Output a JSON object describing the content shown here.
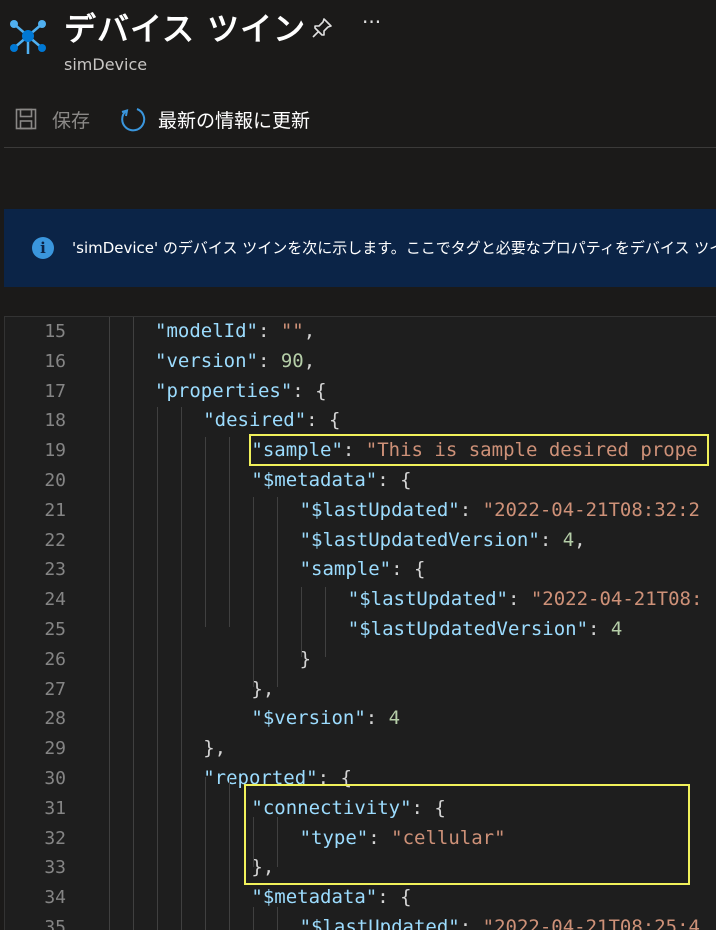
{
  "header": {
    "title": "デバイス ツイン",
    "subtitle": "simDevice",
    "more_label": "···"
  },
  "toolbar": {
    "save_label": "保存",
    "refresh_label": "最新の情報に更新"
  },
  "info_bar": {
    "icon_glyph": "i",
    "message": "'simDevice' のデバイス ツインを次に示します。ここでタグと必要なプロパティをデバイス ツイン"
  },
  "editor": {
    "lines": [
      {
        "num": "15",
        "tokens": [
          [
            "k",
            "\"modelId\""
          ],
          [
            "p",
            ": "
          ],
          [
            "s",
            "\"\""
          ],
          [
            "p",
            ","
          ]
        ]
      },
      {
        "num": "16",
        "tokens": [
          [
            "k",
            "\"version\""
          ],
          [
            "p",
            ": "
          ],
          [
            "n",
            "90"
          ],
          [
            "p",
            ","
          ]
        ]
      },
      {
        "num": "17",
        "tokens": [
          [
            "k",
            "\"properties\""
          ],
          [
            "p",
            ": {"
          ]
        ]
      },
      {
        "num": "18",
        "tokens": [
          [
            "k",
            "\"desired\""
          ],
          [
            "p",
            ": {"
          ]
        ]
      },
      {
        "num": "19",
        "tokens": [
          [
            "k",
            "\"sample\""
          ],
          [
            "p",
            ": "
          ],
          [
            "s",
            "\"This is sample desired prope"
          ]
        ]
      },
      {
        "num": "20",
        "tokens": [
          [
            "k",
            "\"$metadata\""
          ],
          [
            "p",
            ": {"
          ]
        ]
      },
      {
        "num": "21",
        "tokens": [
          [
            "k",
            "\"$lastUpdated\""
          ],
          [
            "p",
            ": "
          ],
          [
            "s",
            "\"2022-04-21T08:32:2"
          ]
        ]
      },
      {
        "num": "22",
        "tokens": [
          [
            "k",
            "\"$lastUpdatedVersion\""
          ],
          [
            "p",
            ": "
          ],
          [
            "n",
            "4"
          ],
          [
            "p",
            ","
          ]
        ]
      },
      {
        "num": "23",
        "tokens": [
          [
            "k",
            "\"sample\""
          ],
          [
            "p",
            ": {"
          ]
        ]
      },
      {
        "num": "24",
        "tokens": [
          [
            "k",
            "\"$lastUpdated\""
          ],
          [
            "p",
            ": "
          ],
          [
            "s",
            "\"2022-04-21T08:"
          ]
        ]
      },
      {
        "num": "25",
        "tokens": [
          [
            "k",
            "\"$lastUpdatedVersion\""
          ],
          [
            "p",
            ": "
          ],
          [
            "n",
            "4"
          ]
        ]
      },
      {
        "num": "26",
        "tokens": [
          [
            "p",
            "}"
          ]
        ]
      },
      {
        "num": "27",
        "tokens": [
          [
            "p",
            "},"
          ]
        ]
      },
      {
        "num": "28",
        "tokens": [
          [
            "k",
            "\"$version\""
          ],
          [
            "p",
            ": "
          ],
          [
            "n",
            "4"
          ]
        ]
      },
      {
        "num": "29",
        "tokens": [
          [
            "p",
            "},"
          ]
        ]
      },
      {
        "num": "30",
        "tokens": [
          [
            "k",
            "\"reported\""
          ],
          [
            "p",
            ": {"
          ]
        ]
      },
      {
        "num": "31",
        "tokens": [
          [
            "k",
            "\"connectivity\""
          ],
          [
            "p",
            ": {"
          ]
        ]
      },
      {
        "num": "32",
        "tokens": [
          [
            "k",
            "\"type\""
          ],
          [
            "p",
            ": "
          ],
          [
            "s",
            "\"cellular\""
          ]
        ]
      },
      {
        "num": "33",
        "tokens": [
          [
            "p",
            "},"
          ]
        ]
      },
      {
        "num": "34",
        "tokens": [
          [
            "k",
            "\"$metadata\""
          ],
          [
            "p",
            ": {"
          ]
        ]
      },
      {
        "num": "35",
        "tokens": [
          [
            "k",
            "\"$lastUpdated\""
          ],
          [
            "p",
            ": "
          ],
          [
            "s",
            "\"2022-04-21T08:25:4"
          ]
        ]
      }
    ]
  }
}
